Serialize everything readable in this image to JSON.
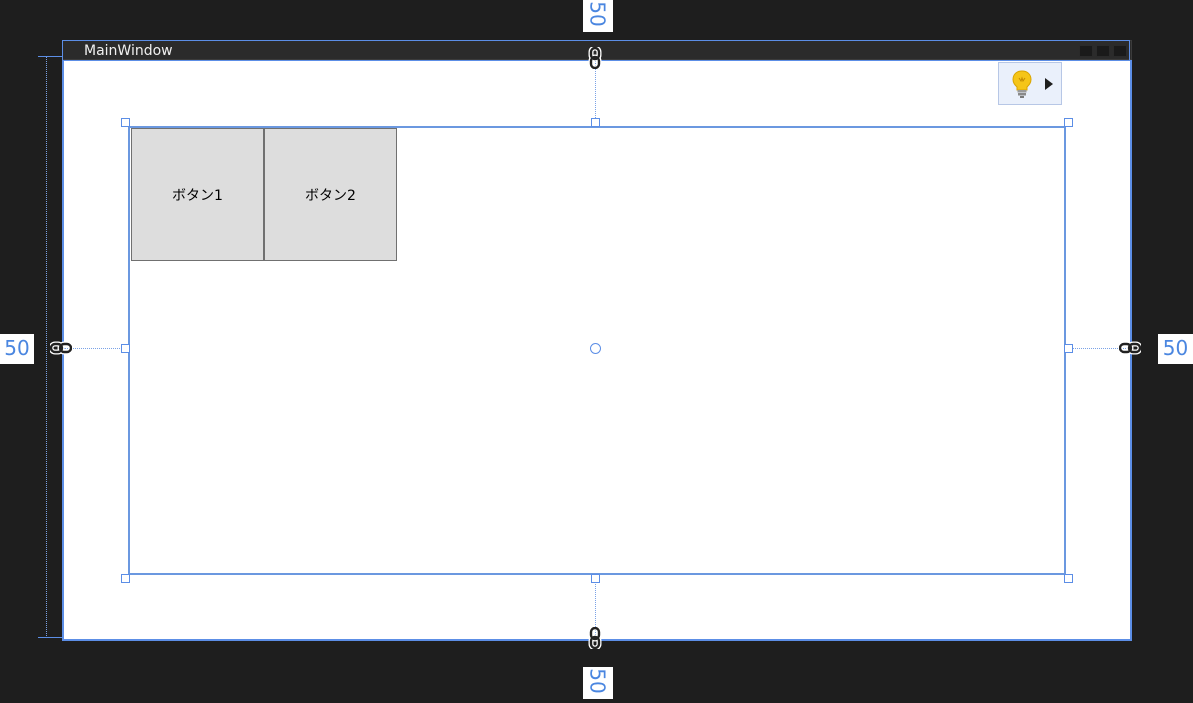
{
  "window": {
    "title": "MainWindow"
  },
  "grid": {
    "margins": {
      "left": "50",
      "top": "50",
      "right": "50",
      "bottom": "50"
    }
  },
  "buttons": [
    {
      "label": "ボタン1"
    },
    {
      "label": "ボタン2"
    }
  ],
  "icons": {
    "margin_lock": "chain-link-icon",
    "quick_actions": "light-bulb-icon",
    "expand": "triangle-right-icon"
  },
  "colors": {
    "canvas": "#1e1e1e",
    "selection": "#5c8ee6",
    "button_face": "#dddddd",
    "button_border": "#707070",
    "window_body": "#ffffff",
    "bulb": "#f5c518"
  }
}
